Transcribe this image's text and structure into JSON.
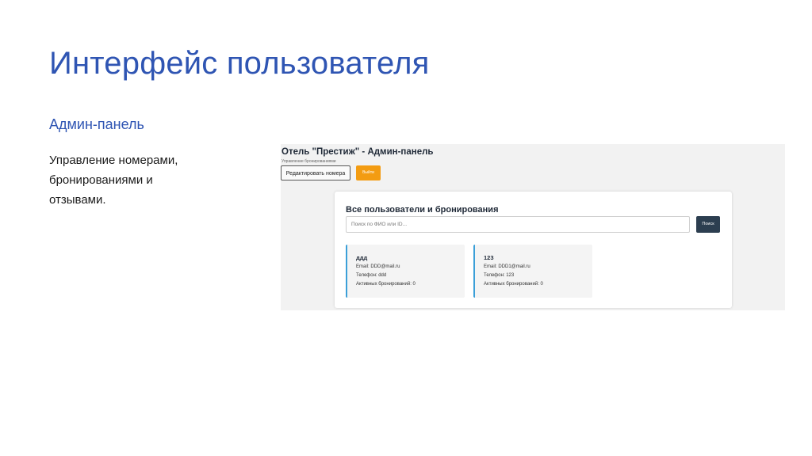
{
  "slide": {
    "title": "Интерфейс пользователя",
    "subtitle": "Админ-панель",
    "description_lines": [
      "Управление номерами,",
      "бронированиями и",
      "отзывами."
    ]
  },
  "admin": {
    "title": "Отель \"Престиж\" - Админ-панель",
    "subtitle": "Управление бронированиями",
    "edit_button": "Редактировать номера",
    "logout_button": "Выйти",
    "panel_title": "Все пользователи и бронирования",
    "search_placeholder": "Поиск по ФИО или ID...",
    "search_button": "Поиск",
    "users": [
      {
        "name": "ддд",
        "email": "Email: DDD@mail.ru",
        "phone": "Телефон: ddd",
        "bookings": "Активных бронирований: 0"
      },
      {
        "name": "123",
        "email": "Email: DDD1@mail.ru",
        "phone": "Телефон: 123",
        "bookings": "Активных бронирований: 0"
      }
    ]
  },
  "colors": {
    "title_blue": "#2f55b3",
    "logout_orange": "#f39c12",
    "search_dark": "#2c3e50",
    "card_accent": "#3b9fd8"
  }
}
